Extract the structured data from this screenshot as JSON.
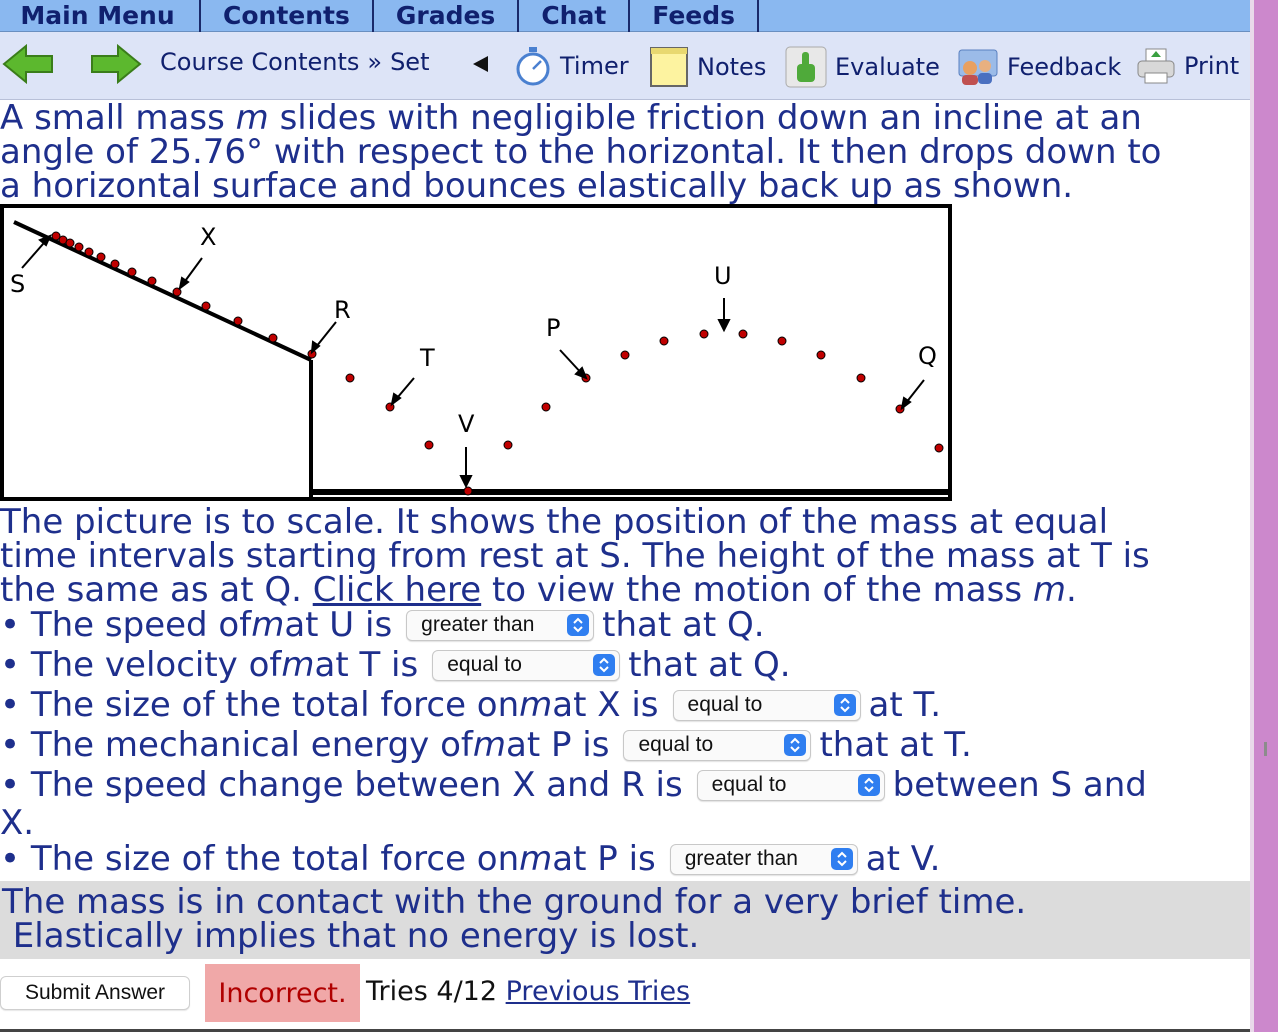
{
  "menu": {
    "tabs": [
      "Main Menu",
      "Contents",
      "Grades",
      "Chat",
      "Feeds"
    ]
  },
  "toolbar": {
    "breadcrumb_contents": "Course Contents",
    "breadcrumb_sep": "»",
    "breadcrumb_set": "Set",
    "timer": "Timer",
    "notes": "Notes",
    "evaluate": "Evaluate",
    "feedback": "Feedback",
    "print": "Print"
  },
  "problem": {
    "line1_a": "A small mass ",
    "mass_symbol": "m",
    "line1_b": " slides with negligible friction down an incline at an",
    "line2": "angle of 25.76° with respect to the horizontal. It then drops down to",
    "line3": "a horizontal surface and bounces elastically back up as shown."
  },
  "figure": {
    "labels": {
      "S": "S",
      "X": "X",
      "R": "R",
      "T": "T",
      "V": "V",
      "P": "P",
      "U": "U",
      "Q": "Q"
    }
  },
  "description": {
    "line1": "The picture is to scale. It shows the position of the mass at equal",
    "line2": "time intervals starting from rest at S. The height of the mass at T is",
    "line3_a": "the same as at Q. ",
    "link": "Click here",
    "line3_b": " to view the motion of the mass ",
    "mass_symbol": "m",
    "line3_c": "."
  },
  "questions": [
    {
      "pre": "• The speed of ",
      "mass": "m",
      "mid": " at U is",
      "value": "greater than",
      "post": "that at Q."
    },
    {
      "pre": "• The velocity of ",
      "mass": "m",
      "mid": " at T is",
      "value": "equal to",
      "post": "that at Q."
    },
    {
      "pre": "• The size of the total force on ",
      "mass": "m",
      "mid": " at X is",
      "value": "equal to",
      "post": "at T."
    },
    {
      "pre": "• The mechanical energy of ",
      "mass": "m",
      "mid": " at P is",
      "value": "equal to",
      "post": "that at T."
    },
    {
      "pre": "• The speed change between X and R is",
      "mass": "",
      "mid": "",
      "value": "equal to",
      "post": "between S and",
      "wrap": "X."
    },
    {
      "pre": "• The size of the total force on ",
      "mass": "m",
      "mid": " at P is",
      "value": "greater than",
      "post": "at V."
    }
  ],
  "hint": {
    "line1": "The mass is in contact with the ground for a very brief time.",
    "line2": " Elastically implies that no energy is lost."
  },
  "footer": {
    "submit": "Submit Answer",
    "status": "Incorrect.",
    "tries": "Tries 4/12",
    "previous": "Previous Tries"
  },
  "colors": {
    "menu_bg": "#8ab8f0",
    "toolbar_bg": "#dde4f7",
    "text": "#1e2f8c",
    "status_bg": "#f0a8a8",
    "status_text": "#b00000",
    "hint_bg": "#dcdcdc",
    "select_accent": "#2f7ef0",
    "side_strip": "#cc88cc"
  }
}
